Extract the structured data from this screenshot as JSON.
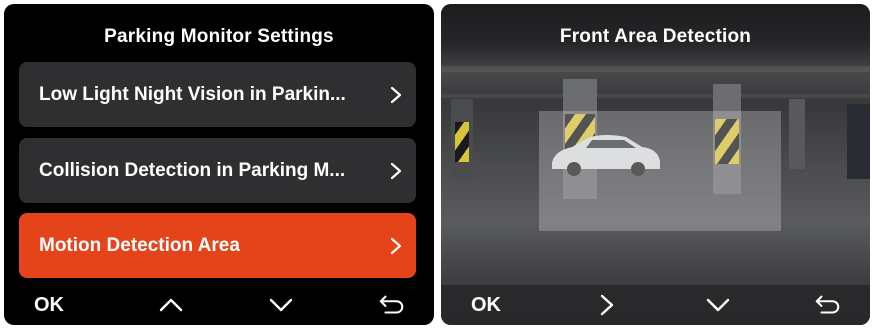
{
  "left_screen": {
    "title": "Parking Monitor Settings",
    "menu": [
      {
        "label": "Low Light Night Vision in Parkin...",
        "selected": false
      },
      {
        "label": "Collision Detection in Parking M...",
        "selected": false
      },
      {
        "label": "Motion Detection Area",
        "selected": true
      }
    ],
    "bottom_bar": {
      "ok_label": "OK",
      "icons": [
        "chevron-up-icon",
        "chevron-down-icon",
        "back-arrow-icon"
      ]
    }
  },
  "right_screen": {
    "title": "Front Area Detection",
    "bottom_bar": {
      "ok_label": "OK",
      "icons": [
        "chevron-right-icon",
        "chevron-down-icon",
        "back-arrow-icon"
      ]
    }
  },
  "colors": {
    "accent": "#e5431a",
    "menu_bg": "#2f2f31",
    "screen_bg": "#000000",
    "text": "#ffffff"
  }
}
